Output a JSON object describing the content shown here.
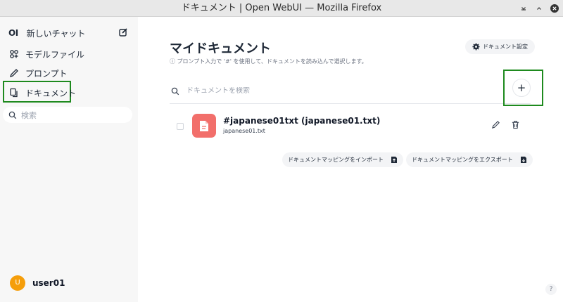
{
  "window": {
    "title": "ドキュメント | Open WebUI — Mozilla Firefox"
  },
  "sidebar": {
    "logo": "OI",
    "new_chat": "新しいチャット",
    "items": [
      {
        "label": "モデルファイル",
        "icon": "models-icon"
      },
      {
        "label": "プロンプト",
        "icon": "pencil-icon"
      },
      {
        "label": "ドキュメント",
        "icon": "documents-icon",
        "highlighted": true
      }
    ],
    "search_placeholder": "検索",
    "user": {
      "initial": "U",
      "name": "user01"
    }
  },
  "main": {
    "title": "マイドキュメント",
    "subtitle": "ⓘ プロンプト入力で '#' を使用して、ドキュメントを読み込んで選択します。",
    "settings_button": "ドキュメント設定",
    "search_placeholder": "ドキュメントを検索",
    "add_button": "+",
    "documents": [
      {
        "title": "#japanese01txt (japanese01.txt)",
        "filename": "japanese01.txt"
      }
    ],
    "import_button": "ドキュメントマッピングをインポート",
    "export_button": "ドキュメントマッピングをエクスポート"
  },
  "help": "?",
  "colors": {
    "highlight_box": "#1e8a1e",
    "doc_icon_bg": "#f26f6b",
    "avatar_bg": "#f59e0b",
    "sidebar_bg": "#f7f7f7"
  }
}
